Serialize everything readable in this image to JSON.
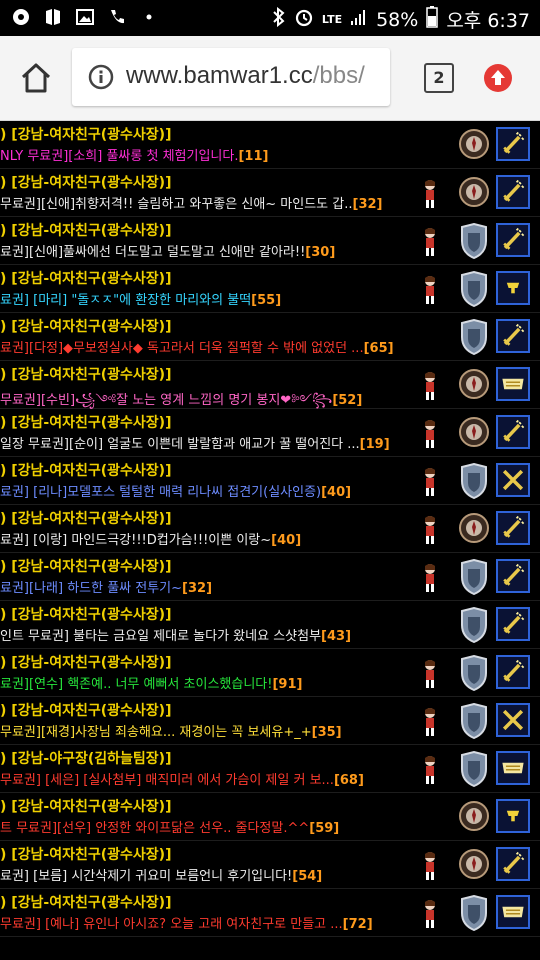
{
  "status_bar": {
    "network_label": "LTE",
    "battery": "58%",
    "time": "오후 6:37",
    "left_icons": [
      "app-icon",
      "gallery-icon",
      "image-icon",
      "phone-icon",
      "dot-icon"
    ]
  },
  "browser": {
    "url_host": "www.bamwar1.cc",
    "url_path": "/bbs/",
    "tab_count": "2"
  },
  "colors": {
    "author": "#f0d000",
    "count": "#ff9b1c",
    "badge_border": "#2f63d8",
    "badge_bg": "#0a1234"
  },
  "posts": [
    {
      "author": ") [강남-여자친구(광수사장)]",
      "title": "NLY 무료권][소희] 풀싸롱 첫 체험기입니다.",
      "count": "[11]",
      "title_color": "magenta",
      "icon1": "medal",
      "icon2": "sword",
      "has_char": false
    },
    {
      "author": ") [강남-여자친구(광수사장)]",
      "title": "무료권][신애]취향저격!! 슬림하고 와꾸좋은 신애~ 마인드도 갑..",
      "count": "[32]",
      "title_color": "white",
      "icon1": "medal",
      "icon2": "sword",
      "has_char": true
    },
    {
      "author": ") [강남-여자친구(광수사장)]",
      "title": "료권][신애]풀싸에선 더도말고 덜도말고 신애만 같아라!!",
      "count": "[30]",
      "title_color": "white",
      "icon1": "shield",
      "icon2": "sword",
      "has_char": true
    },
    {
      "author": ") [강남-여자친구(광수사장)]",
      "title": "료권] [마리] \"돌ㅈㅈ\"에 환장한 마리와의 불떡",
      "count": "[55]",
      "title_color": "cyan",
      "icon1": "shield",
      "icon2": "cup",
      "has_char": true
    },
    {
      "author": ") [강남-여자친구(광수사장)]",
      "title": "료권][다정]◆무보정실사◆ 독고라서 더욱 질퍽할 수 밖에 없었던 ...",
      "count": "[65]",
      "title_color": "red",
      "icon1": "shield",
      "icon2": "sword",
      "has_char": false
    },
    {
      "author": ") [강남-여자친구(광수사장)]",
      "title": "무료권][수빈]꧁༺잘 노는 영계 느낌의 명기 봉지❤༻꧂",
      "count": "[52]",
      "title_color": "pink",
      "icon1": "medal",
      "icon2": "crown",
      "has_char": true
    },
    {
      "author": ") [강남-여자친구(광수사장)]",
      "title": "일장 무료권][순이] 얼굴도 이쁜데 발랄함과 애교가 꿀 떨어진다 ...",
      "count": "[19]",
      "title_color": "white",
      "icon1": "medal",
      "icon2": "sword",
      "has_char": true
    },
    {
      "author": ") [강남-여자친구(광수사장)]",
      "title": "료권] [리나]모델포스 털털한 매력 리나씨 접견기(실사인증)",
      "count": "[40]",
      "title_color": "blue",
      "icon1": "shield",
      "icon2": "cross",
      "has_char": true
    },
    {
      "author": ") [강남-여자친구(광수사장)]",
      "title": "료권] [이랑] 마인드극강!!!D컵가슴!!!이쁜 이랑~",
      "count": "[40]",
      "title_color": "white",
      "icon1": "medal",
      "icon2": "sword",
      "has_char": true
    },
    {
      "author": ") [강남-여자친구(광수사장)]",
      "title": "료권][나래] 하드한 풀싸 전투기~",
      "count": "[32]",
      "title_color": "blue",
      "icon1": "shield",
      "icon2": "sword",
      "has_char": true
    },
    {
      "author": ") [강남-여자친구(광수사장)]",
      "title": "인트 무료권] 불타는 금요일 제대로 놀다가 왔네요 스샷첨부",
      "count": "[43]",
      "title_color": "white",
      "icon1": "shield",
      "icon2": "sword",
      "has_char": false
    },
    {
      "author": ") [강남-여자친구(광수사장)]",
      "title": "료권][연수] 핵존예.. 너무 예뻐서 초이스했습니다!",
      "count": "[91]",
      "title_color": "green",
      "icon1": "shield",
      "icon2": "sword",
      "has_char": true
    },
    {
      "author": ") [강남-여자친구(광수사장)]",
      "title": "무료권][재경]사장님 죄송해요... 재경이는 꼭 보세유+_+",
      "count": "[35]",
      "title_color": "yellow",
      "icon1": "shield",
      "icon2": "cross",
      "has_char": true
    },
    {
      "author": ") [강남-야구장(김하늘팀장)]",
      "title": "무료권] [세은] [실사첨부] 매직미러 에서 가슴이 제일 커 보...",
      "count": "[68]",
      "title_color": "red",
      "icon1": "shield",
      "icon2": "crown",
      "has_char": true
    },
    {
      "author": ") [강남-여자친구(광수사장)]",
      "title": "트 무료권][선우] 안정한 와이프닮은 선우.. 줄다정말.^^",
      "count": "[59]",
      "title_color": "red",
      "icon1": "medal",
      "icon2": "cup",
      "has_char": false
    },
    {
      "author": ") [강남-여자친구(광수사장)]",
      "title": "료권] [보름] 시간삭제기 귀요미 보름언니 후기입니다!",
      "count": "[54]",
      "title_color": "white",
      "icon1": "medal",
      "icon2": "sword",
      "has_char": true
    },
    {
      "author": ") [강남-여자친구(광수사장)]",
      "title": "무료권] [예나] 유인나 아시죠? 오늘 고래 여자친구로 만들고 ...",
      "count": "[72]",
      "title_color": "red",
      "icon1": "shield",
      "icon2": "crown",
      "has_char": true
    }
  ]
}
